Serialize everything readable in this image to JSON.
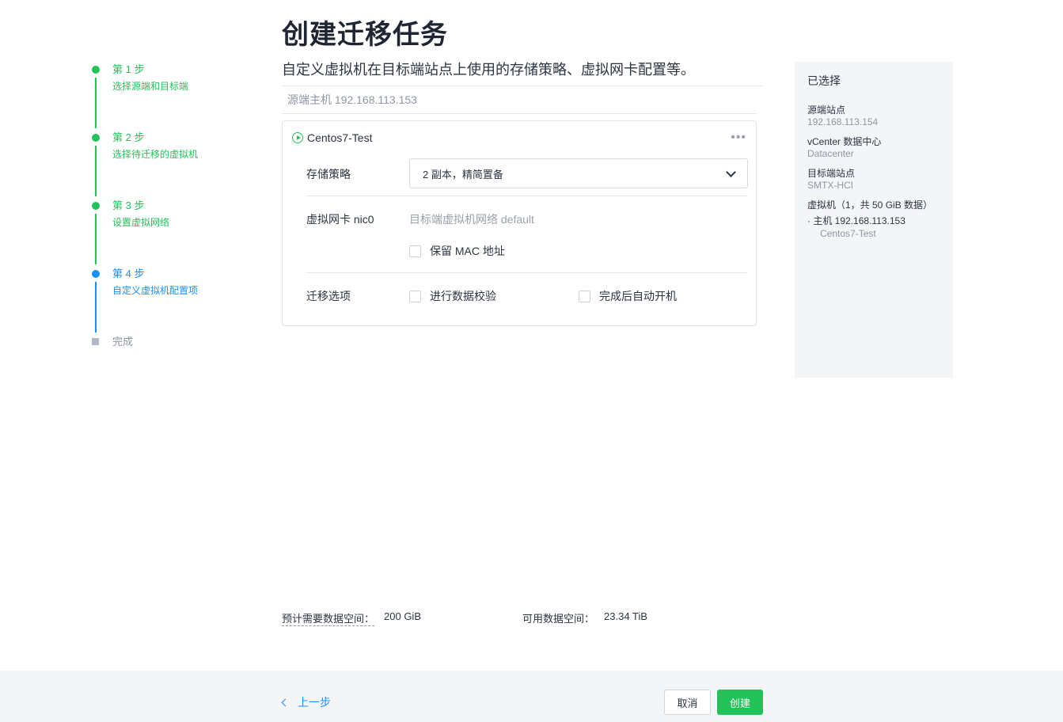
{
  "steps": [
    {
      "num": "第 1 步",
      "desc": "选择源端和目标端"
    },
    {
      "num": "第 2 步",
      "desc": "选择待迁移的虚拟机"
    },
    {
      "num": "第 3 步",
      "desc": "设置虚拟网络"
    },
    {
      "num": "第 4 步",
      "desc": "自定义虚拟机配置项"
    },
    {
      "num": "完成"
    }
  ],
  "main": {
    "title": "创建迁移任务",
    "subtitle": "自定义虚拟机在目标端站点上使用的存储策略、虚拟网卡配置等。",
    "host_label": "源端主机 192.168.113.153",
    "vm": {
      "name": "Centos7-Test",
      "more": "•••",
      "storage_label": "存储策略",
      "storage_value": "2 副本，精简置备",
      "nic_label": "虚拟网卡 nic0",
      "nic_value": "目标端虚拟机网络 default",
      "keep_mac": "保留 MAC 地址",
      "options_label": "迁移选项",
      "verify": "进行数据校验",
      "autostart": "完成后自动开机"
    }
  },
  "summary": {
    "title": "已选择",
    "source_label": "源端站点",
    "source_value": "192.168.113.154",
    "vcenter_label": "vCenter 数据中心",
    "vcenter_value": "Datacenter",
    "target_label": "目标端站点",
    "target_value": "SMTX-HCI",
    "vm_label": "虚拟机（1，共 50 GiB 数据）",
    "host": "· 主机 192.168.113.153",
    "vm_name": "Centos7-Test"
  },
  "space": {
    "needed_label": "预计需要数据空间：",
    "needed_value": "200 GiB",
    "available_label": "可用数据空间：",
    "available_value": "23.34 TiB"
  },
  "footer": {
    "back": "上一步",
    "cancel": "取消",
    "create": "创建"
  },
  "colors": {
    "done": "#22c25b",
    "active": "#1890ff",
    "pending": "#b3b9c4"
  }
}
